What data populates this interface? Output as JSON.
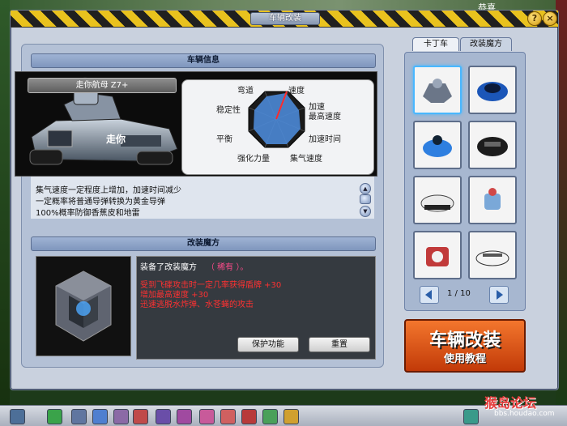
{
  "window": {
    "title": "车辆改装",
    "top_right_text": "恭喜"
  },
  "vehicle_info": {
    "header": "车辆信息",
    "name": "走你航母 Z7+",
    "stats": [
      "弯道",
      "速度",
      "加速",
      "最高速度",
      "加速时间",
      "集气速度",
      "强化力量",
      "平衡",
      "稳定性"
    ],
    "description": [
      "集气速度一定程度上增加，加速时间减少",
      "一定概率将普通导弹转换为黄金导弹",
      "100%概率防御香蕉皮和地雷"
    ]
  },
  "mod_magic": {
    "header": "改装魔方",
    "equipped_prefix": "装备了改装魔方",
    "equipped_name": "（ 稀有 ）。",
    "effects": [
      "受到飞碟攻击时一定几率获得盾牌 +30",
      "增加最高速度 +30",
      "迅速逃脱水炸弹、水苍蝇的攻击"
    ],
    "buttons": {
      "protect": "保护功能",
      "reset": "重置"
    }
  },
  "tabs": {
    "kart": "卡丁车",
    "magic": "改装魔方"
  },
  "pagination": {
    "text": "1 / 10"
  },
  "tutorial": {
    "line1": "车辆改装",
    "line2": "使用教程"
  },
  "watermark": {
    "main": "猴岛论坛",
    "sub": "bbs.houdao.com"
  },
  "colors": {
    "effect_red": "#ff3131",
    "equipped_name": "#ff4b8b",
    "accent_orange": "#e85a1b",
    "selected_slot": "#49b7ff"
  }
}
